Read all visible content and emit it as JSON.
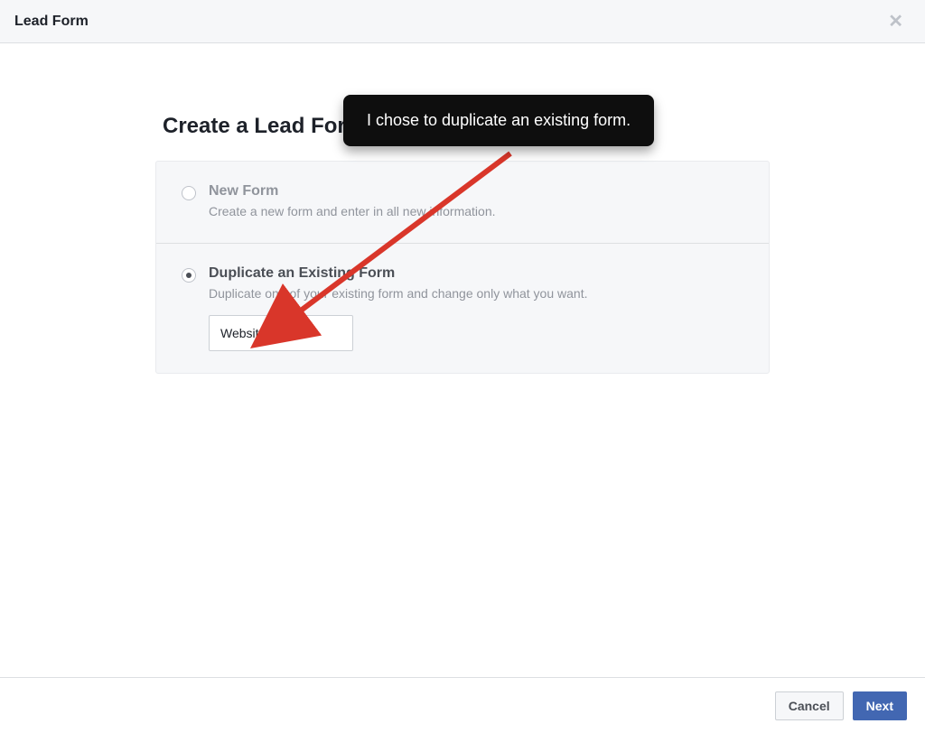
{
  "header": {
    "title": "Lead Form"
  },
  "main": {
    "heading": "Create a Lead Form",
    "options": {
      "newForm": {
        "title": "New Form",
        "desc": "Create a new form and enter in all new information."
      },
      "duplicate": {
        "title": "Duplicate an Existing Form",
        "desc": "Duplicate one of your existing form and change only what you want.",
        "selectedValue": "Website quote"
      }
    }
  },
  "footer": {
    "cancel": "Cancel",
    "next": "Next"
  },
  "annotation": {
    "text": "I chose to duplicate an existing form."
  }
}
